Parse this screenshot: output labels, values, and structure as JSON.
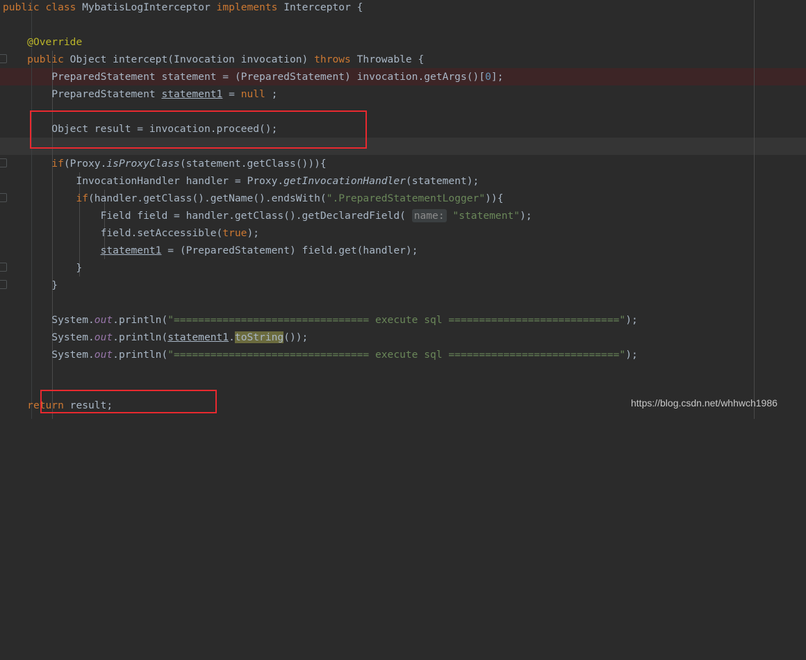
{
  "editor": {
    "background_color": "#2b2b2b",
    "default_text_color": "#a9b7c6",
    "keyword_color": "#cc7832",
    "string_color": "#6a8759",
    "number_color": "#6897bb",
    "annotation_color": "#bbb529",
    "static_field_color": "#9876aa",
    "error_line_color": "#3d2526",
    "caret_line_color": "#353535",
    "annotation_rect_color": "#e8292f",
    "highlight_identifier_color": "#6b6b3e"
  },
  "watermark": {
    "text": "https://blog.csdn.net/whhwch1986"
  },
  "code": {
    "language": "Java",
    "lines": [
      {
        "n": 1,
        "text": "public class MybatisLogInterceptor implements Interceptor {"
      },
      {
        "n": 2,
        "text": ""
      },
      {
        "n": 3,
        "text": "    @Override"
      },
      {
        "n": 4,
        "text": "    public Object intercept(Invocation invocation) throws Throwable {"
      },
      {
        "n": 5,
        "text": "        PreparedStatement statement = (PreparedStatement) invocation.getArgs()[0];"
      },
      {
        "n": 6,
        "text": "        PreparedStatement statement1 = null ;"
      },
      {
        "n": 7,
        "text": ""
      },
      {
        "n": 8,
        "text": "        Object result = invocation.proceed();"
      },
      {
        "n": 9,
        "text": ""
      },
      {
        "n": 10,
        "text": "        if(Proxy.isProxyClass(statement.getClass())){"
      },
      {
        "n": 11,
        "text": "            InvocationHandler handler = Proxy.getInvocationHandler(statement);"
      },
      {
        "n": 12,
        "text": "            if(handler.getClass().getName().endsWith(\".PreparedStatementLogger\")){"
      },
      {
        "n": 13,
        "text": "                Field field = handler.getClass().getDeclaredField( name: \"statement\");"
      },
      {
        "n": 14,
        "text": "                field.setAccessible(true);"
      },
      {
        "n": 15,
        "text": "                statement1 = (PreparedStatement) field.get(handler);"
      },
      {
        "n": 16,
        "text": "            }"
      },
      {
        "n": 17,
        "text": "        }"
      },
      {
        "n": 18,
        "text": ""
      },
      {
        "n": 19,
        "text": "        System.out.println(\"================================ execute sql ============================\");"
      },
      {
        "n": 20,
        "text": "        System.out.println(statement1.toString());"
      },
      {
        "n": 21,
        "text": "        System.out.println(\"================================ execute sql ============================\");"
      },
      {
        "n": 22,
        "text": ""
      },
      {
        "n": 23,
        "text": "        return result;"
      }
    ],
    "parameter_hints": [
      {
        "line": 13,
        "label": "name:"
      }
    ],
    "highlighted_identifier": "toString",
    "warning_underlined_identifiers": [
      "statement1"
    ]
  },
  "annotations": [
    {
      "id": "rect-proceed",
      "target_line": 8,
      "label": "Object result = invocation.proceed();"
    },
    {
      "id": "rect-return",
      "target_line": 23,
      "label": "return result;"
    }
  ]
}
